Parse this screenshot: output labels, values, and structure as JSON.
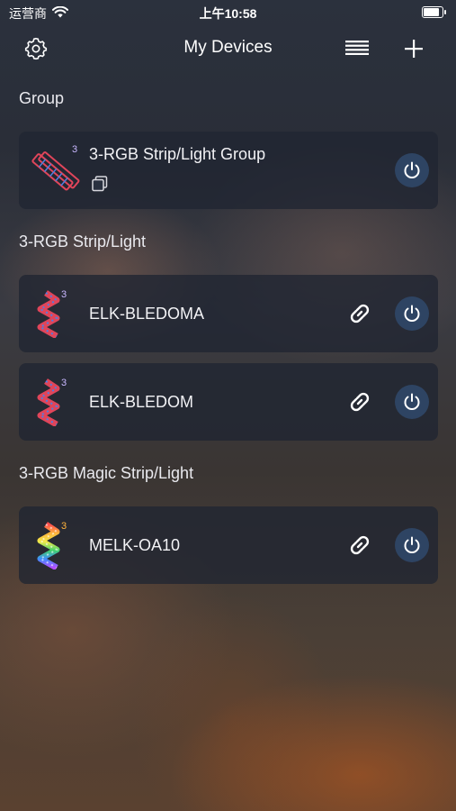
{
  "status_bar": {
    "carrier": "运营商",
    "time": "上午10:58",
    "battery_level": 0.95
  },
  "nav": {
    "title": "My Devices",
    "settings_icon": "gear-icon",
    "list_icon": "list-icon",
    "add_icon": "plus-icon"
  },
  "sections": {
    "group": {
      "title": "Group"
    },
    "rgb_strip": {
      "title": "3-RGB Strip/Light"
    },
    "magic_strip": {
      "title": "3-RGB Magic Strip/Light"
    }
  },
  "devices": {
    "group_1": {
      "name": "3-RGB Strip/Light Group",
      "badge": "3",
      "icon": "led-strip-group-icon"
    },
    "strip_1": {
      "name": "ELK-BLEDOMA",
      "badge": "3",
      "icon": "led-strip-icon"
    },
    "strip_2": {
      "name": "ELK-BLEDOM",
      "badge": "3",
      "icon": "led-strip-icon"
    },
    "magic_1": {
      "name": "MELK-OA10",
      "badge": "3",
      "icon": "magic-led-strip-icon"
    }
  },
  "colors": {
    "card_bg": "#202632",
    "power_btn_bg": "#2e4463",
    "strip_red": "#e0455a",
    "strip_blue": "#4f7fe0"
  }
}
